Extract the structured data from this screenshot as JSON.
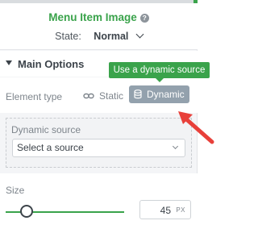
{
  "header": {
    "title": "Menu Item Image",
    "help_icon": "question-circle-icon",
    "state_label": "State:",
    "state_value": "Normal"
  },
  "section": {
    "title": "Main Options",
    "expanded": true
  },
  "element_type": {
    "label": "Element type",
    "options": [
      {
        "label": "Static",
        "icon": "link-icon",
        "selected": false
      },
      {
        "label": "Dynamic",
        "icon": "database-icon",
        "selected": true
      }
    ],
    "tooltip": "Use a dynamic source"
  },
  "dynamic_source": {
    "label": "Dynamic source",
    "selected": "Select a source"
  },
  "size": {
    "label": "Size",
    "value": "45",
    "unit": "PX"
  },
  "colors": {
    "accent": "#3aa34b",
    "selected_button": "#93a1ad",
    "annotation_arrow": "#e8403a"
  }
}
